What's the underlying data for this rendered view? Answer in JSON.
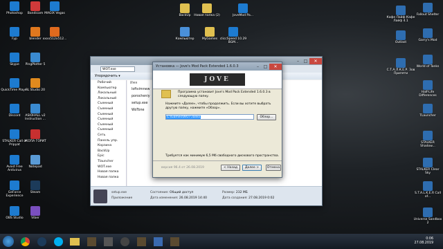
{
  "desktop": {
    "icons_left": [
      {
        "label": "Photoshop",
        "color": "#1d7bd0"
      },
      {
        "label": "Fyp",
        "color": "#1d7bd0"
      },
      {
        "label": "Skype",
        "color": "#1d7bd0"
      },
      {
        "label": "QuickTime Player",
        "color": "#1d7bd0"
      },
      {
        "label": "Discord",
        "color": "#1d7bd0"
      },
      {
        "label": "STALKER Call of Pripyat",
        "color": "#1d7bd0"
      },
      {
        "label": "Avast Free Antivirus",
        "color": "#1d7bd0"
      },
      {
        "label": "GeForce Experience",
        "color": "#1d7bd0"
      },
      {
        "label": "OBS Studio",
        "color": "#1d7bd0"
      }
    ],
    "icons_col2": [
      {
        "label": "Bandicam",
        "color": "#d03a3a"
      },
      {
        "label": "blender",
        "color": "#e0781e"
      },
      {
        "label": "PingPlotter 5",
        "color": "#3a8ad0"
      },
      {
        "label": "FL Studio 20",
        "color": "#e08a1e"
      },
      {
        "label": "ASIOHALL v2 Instruction ...",
        "color": "#3a8ad0"
      },
      {
        "label": "ЖОПА ГОРИТ",
        "color": "#c83030"
      },
      {
        "label": "Notepad",
        "color": "#5a9bd6"
      },
      {
        "label": "Steam",
        "color": "#1c3b5a"
      },
      {
        "label": "Viber",
        "color": "#7a4fbf"
      }
    ],
    "icons_col3": [
      {
        "label": "MAGIX Vegas",
        "color": "#1d7bd0"
      },
      {
        "label": "xxxx512x512...",
        "color": "#e06a1e"
      }
    ],
    "icons_top_mid": [
      {
        "label": "BackUp",
        "color": "#e0c050"
      },
      {
        "label": "Новая папка (2)",
        "color": "#e0c050"
      },
      {
        "label": "JoveMod Pa...",
        "color": "#1d7bd0"
      },
      {
        "label": "Компьютер",
        "color": "#4a90d9"
      },
      {
        "label": "MyGames",
        "color": "#e0c050"
      },
      {
        "label": "cliccSpeed 10.29 BGM...",
        "color": "#1d7bd0"
      }
    ],
    "icons_right": [
      {
        "label": "Fallout Shelter",
        "color": "#2e6db0"
      },
      {
        "label": "Кафе Лайф Кафе Лайф 4.1",
        "color": "#2e6db0"
      },
      {
        "label": "Garry's Mod",
        "color": "#2e6db0"
      },
      {
        "label": "Outlast",
        "color": "#2e6db0"
      },
      {
        "label": "World of Tanks",
        "color": "#2e6db0"
      },
      {
        "label": "С.Т.А.Л.К.Е.Р. Зов Припяти",
        "color": "#2e6db0"
      },
      {
        "label": "Half-Life Differences",
        "color": "#2e6db0"
      },
      {
        "label": "TLauncher",
        "color": "#2e6db0"
      },
      {
        "label": "STALKER Shadow...",
        "color": "#2e6db0"
      },
      {
        "label": "STALKER Clear Sky",
        "color": "#2e6db0"
      },
      {
        "label": "S.T.A.L.K.E.R Call of...",
        "color": "#2e6db0"
      },
      {
        "label": "Universe Sandbox 2",
        "color": "#2e6db0"
      }
    ]
  },
  "explorer": {
    "address": "WOT.exe",
    "organize": "Упорядочить ▾",
    "nav_items": [
      "Рабочий",
      "Компьютер",
      "Локальный",
      "Локальный",
      "Съемный",
      "Съемный",
      "Съемный",
      "Съемный",
      "Съемный",
      "Съемный",
      "Сеть",
      "Панель упр.",
      "Корзина",
      "BackUp",
      "Epic",
      "Tlauncher",
      "WOT.exe",
      "Новая папка",
      "Новая папка"
    ],
    "list_header": "Имя",
    "files": [
      "loftvimnew",
      "porocheniy",
      "setup.exe",
      "WoTone"
    ],
    "details": {
      "filename": "setup.exe",
      "type": "Приложение",
      "state_label": "Состояние:",
      "state_value": "Общий доступ",
      "modified_label": "Дата изменения:",
      "modified_value": "26.08.2019 14:40",
      "size_label": "Размер:",
      "size_value": "232 МБ",
      "created_label": "Дата создания:",
      "created_value": "27.08.2019 0:02"
    }
  },
  "installer": {
    "title": "Установка — Jove's Mod Pack Extended 1.6.0.3",
    "logo_text": "JOVE",
    "line1": "Программа установит Jove's Mod Pack Extended 1.6.0.3 в следующую папку.",
    "line2": "Нажмите «Далее», чтобы продолжить. Если вы хотите выбрать другую папку, нажмите «Обзор».",
    "path_value": "C:\\Games\\WOT\\Tanks",
    "browse": "Обзор...",
    "space_note": "Требуется как минимум 6,5 Мб свободного дискового пространства.",
    "version": "версия 96.4 от 26.08.2019",
    "back": "< Назад",
    "next": "Далее >",
    "cancel": "Отмена"
  },
  "taskbar": {
    "time": "0:06",
    "date": "27.08.2019"
  }
}
